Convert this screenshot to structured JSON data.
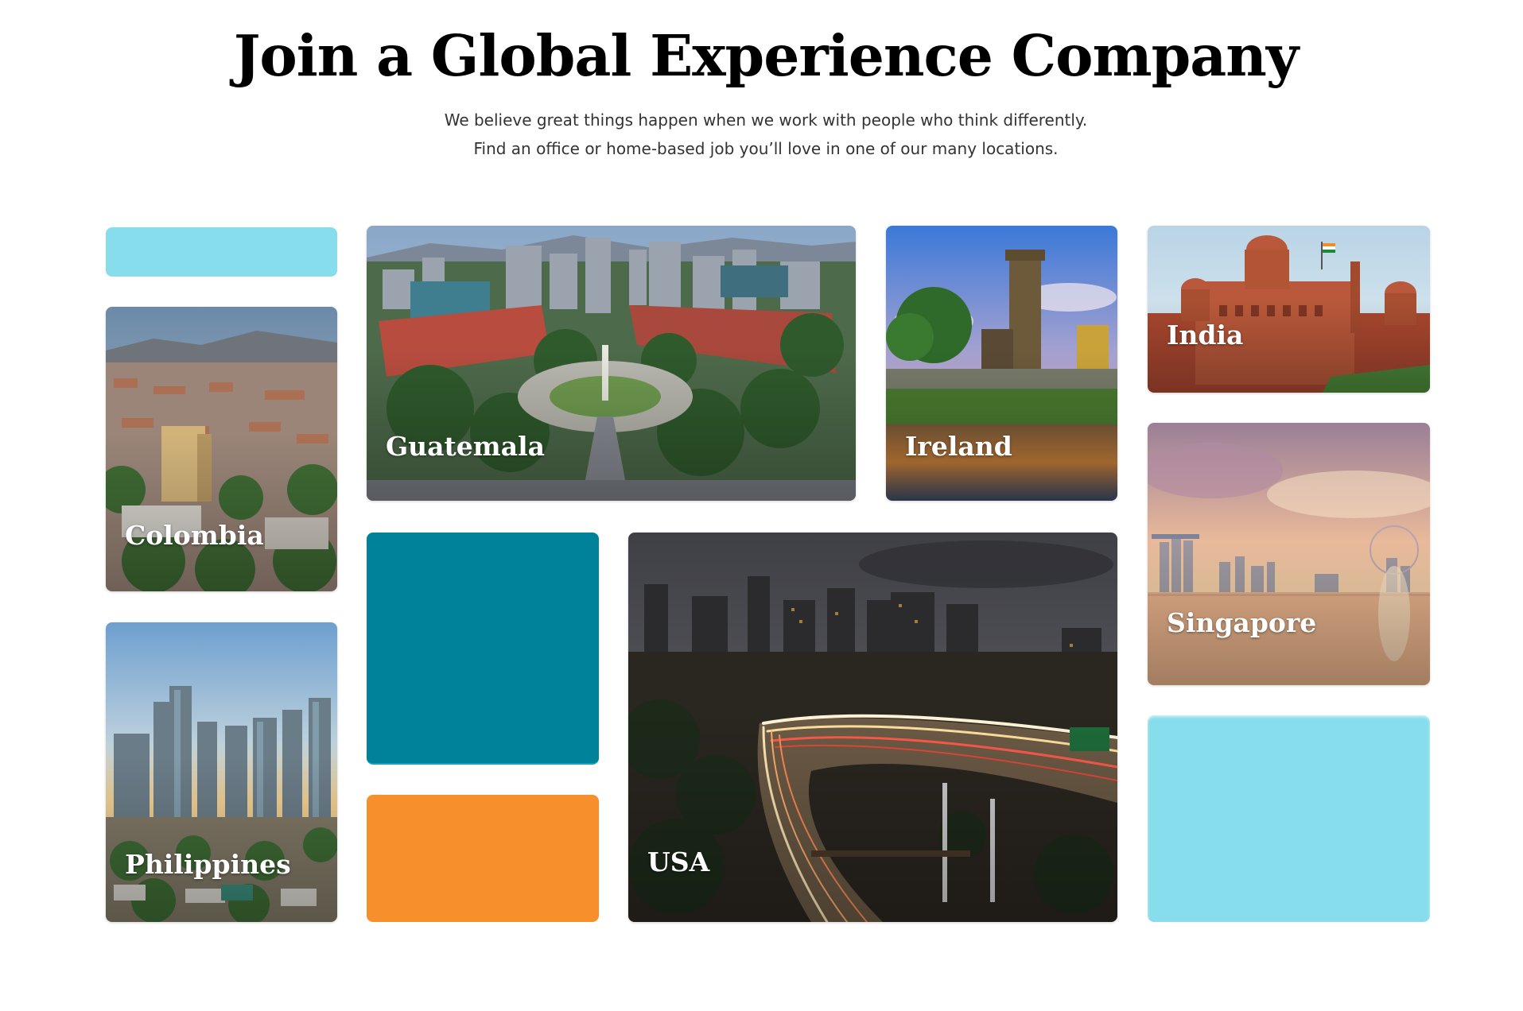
{
  "heading": {
    "title": "Join a Global Experience Company",
    "intro": "We believe great things happen when we work with people who think differently. Find an office or home-based job you’ll love in one of our many locations."
  },
  "colors": {
    "light_cyan": "#88dded",
    "teal": "#00829b",
    "orange": "#f7902c",
    "label_text": "#ffffff"
  },
  "locations": [
    {
      "name": "Guatemala"
    },
    {
      "name": "Ireland"
    },
    {
      "name": "India"
    },
    {
      "name": "Colombia"
    },
    {
      "name": "Singapore"
    },
    {
      "name": "Philippines"
    },
    {
      "name": "USA"
    }
  ]
}
